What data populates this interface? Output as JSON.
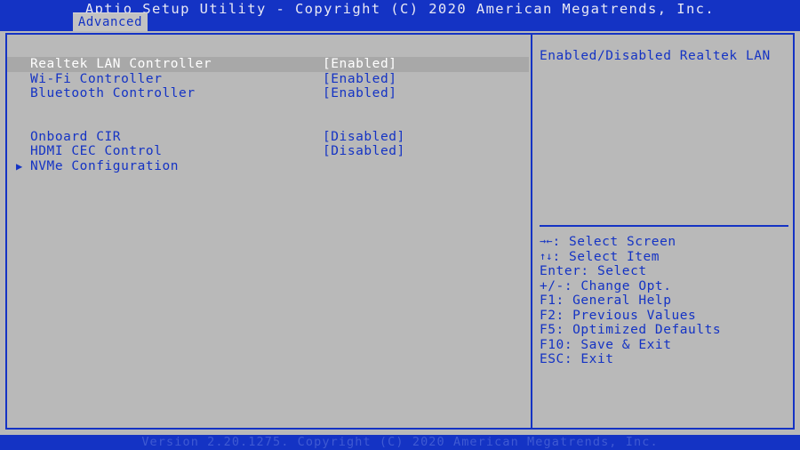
{
  "colors": {
    "blue": "#1433c4",
    "panel_bg": "#b9b9b9",
    "title_text": "#e8e8f4",
    "selected_bg": "#a8a8a8",
    "selected_text": "#ffffff",
    "footer_text": "#3f5ad2"
  },
  "titlebar": {
    "title": "Aptio Setup Utility - Copyright (C) 2020 American Megatrends, Inc.",
    "active_tab": "Advanced"
  },
  "main": {
    "items": [
      {
        "label": "Realtek LAN Controller",
        "value": "[Enabled]",
        "selected": true,
        "submenu": false
      },
      {
        "label": "Wi-Fi Controller",
        "value": "[Enabled]",
        "selected": false,
        "submenu": false
      },
      {
        "label": "Bluetooth Controller",
        "value": "[Enabled]",
        "selected": false,
        "submenu": false
      },
      {
        "label": "Onboard CIR",
        "value": "[Disabled]",
        "selected": false,
        "submenu": false
      },
      {
        "label": "HDMI CEC Control",
        "value": "[Disabled]",
        "selected": false,
        "submenu": false
      },
      {
        "label": "NVMe Configuration",
        "value": "",
        "selected": false,
        "submenu": true
      }
    ],
    "submenu_glyph": "▶"
  },
  "help": {
    "text": "Enabled/Disabled Realtek LAN"
  },
  "keys": [
    {
      "glyph": "→←",
      "text": ": Select Screen"
    },
    {
      "glyph": "↑↓",
      "text": ": Select Item"
    },
    {
      "glyph": "",
      "text": "Enter: Select"
    },
    {
      "glyph": "",
      "text": "+/-: Change Opt."
    },
    {
      "glyph": "",
      "text": "F1: General Help"
    },
    {
      "glyph": "",
      "text": "F2: Previous Values"
    },
    {
      "glyph": "",
      "text": "F5: Optimized Defaults"
    },
    {
      "glyph": "",
      "text": "F10: Save & Exit"
    },
    {
      "glyph": "",
      "text": "ESC: Exit"
    }
  ],
  "footer": {
    "text": "Version 2.20.1275. Copyright (C) 2020 American Megatrends, Inc."
  }
}
